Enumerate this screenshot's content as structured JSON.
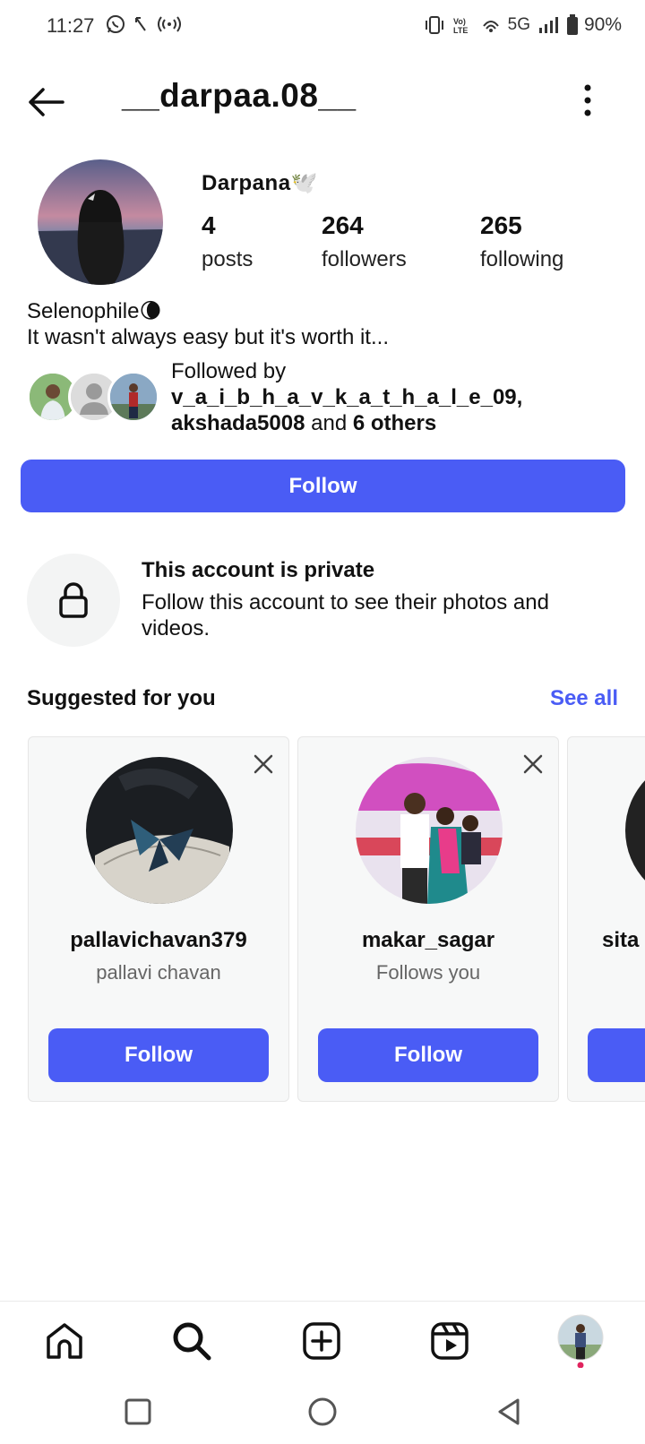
{
  "status_bar": {
    "time": "11:27",
    "network": "5G",
    "battery": "90%",
    "icons": [
      "whatsapp-icon",
      "missed-call-icon",
      "hotspot-icon",
      "vibrate-icon",
      "volte-icon",
      "wifi-calling-icon",
      "signal-icon",
      "battery-icon"
    ]
  },
  "header": {
    "username": "__darpaa.08__"
  },
  "profile": {
    "display_name": "Darpana",
    "display_name_emoji": "🕊️",
    "stats": [
      {
        "number": "4",
        "label": "posts"
      },
      {
        "number": "264",
        "label": "followers"
      },
      {
        "number": "265",
        "label": "following"
      }
    ],
    "bio_line1": "Selenophile",
    "bio_emoji": "🌘",
    "bio_line2": "It wasn't always easy but it's worth it...",
    "followed_by_prefix": "Followed by",
    "followed_by_user1": "v_a_i_b_h_a_v_k_a_t_h_a_l_e_09",
    "followed_by_user2": "akshada5008",
    "followed_by_and": "and",
    "followed_by_others": "6 others",
    "follow_label": "Follow"
  },
  "private": {
    "title": "This account is private",
    "description": "Follow this account to see their photos and videos."
  },
  "suggested": {
    "title": "Suggested for you",
    "see_all": "See all",
    "cards": [
      {
        "username": "pallavichavan379",
        "subtitle": "pallavi chavan",
        "follow": "Follow"
      },
      {
        "username": "makar_sagar",
        "subtitle": "Follows you",
        "follow": "Follow"
      },
      {
        "username": "sita",
        "subtitle": "",
        "follow": ""
      }
    ]
  },
  "colors": {
    "accent": "#4a5cf5",
    "notification_dot": "#e0245e"
  }
}
